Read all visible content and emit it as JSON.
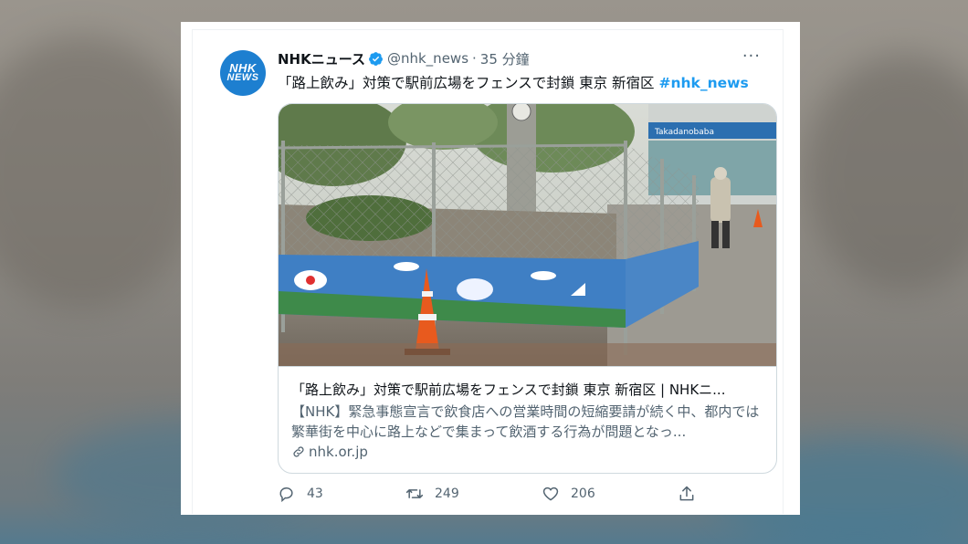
{
  "tweet": {
    "avatar_text_line1": "NHK",
    "avatar_text_line2": "NEWS",
    "display_name": "NHKニュース",
    "handle": "@nhk_news",
    "separator": "·",
    "time": "35 分鐘",
    "text": "「路上飲み」対策で駅前広場をフェンスで封鎖 東京 新宿区",
    "hashtag": "#nhk_news",
    "more_label": "···"
  },
  "link_card": {
    "title": "「路上飲み」対策で駅前広場をフェンスで封鎖 東京 新宿区 | NHKニ...",
    "description": "【NHK】緊急事態宣言で飲食店への営業時間の短縮要請が続く中、都内では繁華街を中心に路上などで集まって飲酒する行為が問題となっ...",
    "domain": "nhk.or.jp",
    "photo_sign_text": "Takadanobaba"
  },
  "actions": {
    "reply_count": "43",
    "retweet_count": "249",
    "like_count": "206"
  },
  "colors": {
    "accent": "#1d9bf0",
    "avatar": "#1d7fd0",
    "text_primary": "#0f1419",
    "text_secondary": "#536471"
  }
}
